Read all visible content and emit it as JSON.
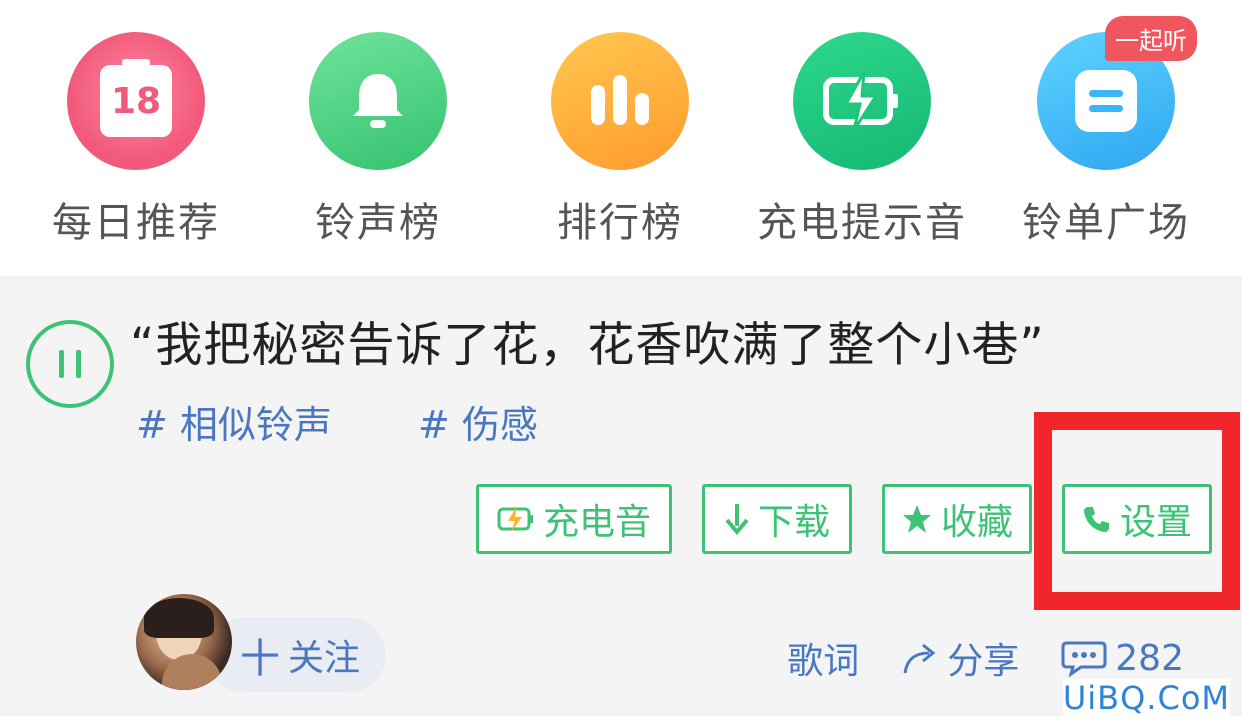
{
  "nav": {
    "items": [
      {
        "label": "每日推荐",
        "icon": "calendar-icon",
        "icon_text": "18",
        "color": "#f2597a"
      },
      {
        "label": "铃声榜",
        "icon": "bell-icon",
        "color": "#44d27e"
      },
      {
        "label": "排行榜",
        "icon": "bar-chart-icon",
        "color": "#ffb12e"
      },
      {
        "label": "充电提示音",
        "icon": "battery-charge-icon",
        "color": "#1ec77c"
      },
      {
        "label": "铃单广场",
        "icon": "list-icon",
        "color": "#38b6f5",
        "badge": "一起听"
      }
    ]
  },
  "song": {
    "quote": "“我把秘密告诉了花，花香吹满了整个小巷”",
    "tags": [
      "# 相似铃声",
      "# 伤感"
    ]
  },
  "buttons": {
    "charge": "充电音",
    "download": "下载",
    "favorite": "收藏",
    "set": "设置"
  },
  "user": {
    "follow": "关注",
    "follow_plus": "十"
  },
  "actions": {
    "lyrics": "歌词",
    "share": "分享",
    "comments": "282"
  },
  "watermark": "UiBQ.CoM",
  "colors": {
    "accent": "#3ec275",
    "link": "#4a78c0",
    "highlight": "#f0262b"
  }
}
